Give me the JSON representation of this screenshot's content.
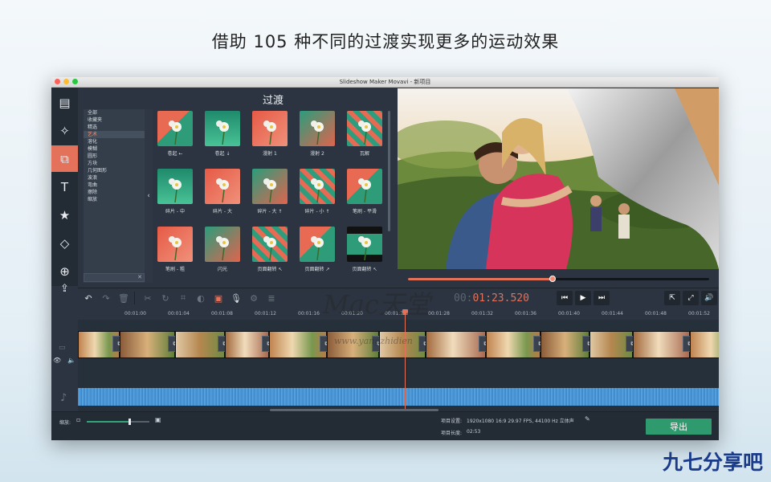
{
  "headline": "借助 105 种不同的过渡实现更多的运动效果",
  "window": {
    "title": "Slideshow Maker Movavi - 新项目",
    "traffic_lights": [
      "#ff5f57",
      "#febc2e",
      "#28c840"
    ]
  },
  "accent_color": "#e4715a",
  "tools": [
    {
      "name": "media-icon",
      "glyph": "▤",
      "active": false
    },
    {
      "name": "magic-wand-icon",
      "glyph": "✧",
      "active": false
    },
    {
      "name": "transitions-icon",
      "glyph": "⧉",
      "active": true
    },
    {
      "name": "text-icon",
      "glyph": "T",
      "active": false
    },
    {
      "name": "sticker-star-icon",
      "glyph": "★",
      "active": false
    },
    {
      "name": "shapes-icon",
      "glyph": "◇",
      "active": false
    },
    {
      "name": "zoom-icon",
      "glyph": "⊕",
      "active": false
    }
  ],
  "export_tool_glyph": "⇪",
  "transitions_panel": {
    "title": "过渡",
    "categories": [
      "全部",
      "收藏夹",
      "精选",
      "艺术",
      "溶化",
      "模糊",
      "圆形",
      "方块",
      "几何图形",
      "波浪",
      "弯曲",
      "擦除",
      "缩放"
    ],
    "selected_category": "艺术",
    "collapse_glyph": "‹",
    "search_clear_glyph": "✕",
    "items": [
      {
        "label": "卷起 ←"
      },
      {
        "label": "卷起 ↓"
      },
      {
        "label": "漫射 1"
      },
      {
        "label": "漫射 2"
      },
      {
        "label": "瓦解"
      },
      {
        "label": "碎片 - 中"
      },
      {
        "label": "碎片 - 大"
      },
      {
        "label": "碎片 - 大 ↑"
      },
      {
        "label": "碎片 - 小 ↑"
      },
      {
        "label": "笔刷 - 平滑"
      },
      {
        "label": "笔刷 - 粗"
      },
      {
        "label": "闪光"
      },
      {
        "label": "页面翻转 ↖"
      },
      {
        "label": "页面翻转 ↗"
      },
      {
        "label": "页面翻转 ↖"
      }
    ]
  },
  "preview": {
    "progress": 0.48
  },
  "toolbar": {
    "timecode_dim": "00:",
    "timecode_live": "01:23.520",
    "buttons": [
      {
        "name": "undo-icon",
        "glyph": "↶",
        "state": "normal"
      },
      {
        "name": "redo-icon",
        "glyph": "↷",
        "state": "dim"
      },
      {
        "name": "delete-icon",
        "glyph": "🗑",
        "state": "dim"
      },
      {
        "name": "cut-icon",
        "glyph": "✂",
        "state": "dim"
      },
      {
        "name": "rotate-icon",
        "glyph": "↻",
        "state": "dim"
      },
      {
        "name": "crop-icon",
        "glyph": "⌗",
        "state": "dim"
      },
      {
        "name": "color-adjust-icon",
        "glyph": "◐",
        "state": "dim"
      },
      {
        "name": "image-icon",
        "glyph": "▣",
        "state": "on"
      },
      {
        "name": "microphone-icon",
        "glyph": "🎙",
        "state": "normal"
      },
      {
        "name": "settings-icon",
        "glyph": "⚙",
        "state": "dim"
      },
      {
        "name": "equalizer-icon",
        "glyph": "≣",
        "state": "dim"
      }
    ],
    "player_buttons": [
      {
        "name": "skip-back-icon",
        "glyph": "⏮"
      },
      {
        "name": "play-icon",
        "glyph": "▶"
      },
      {
        "name": "skip-forward-icon",
        "glyph": "⏭"
      }
    ],
    "right_buttons": [
      {
        "name": "detach-preview-icon",
        "glyph": "⇱"
      },
      {
        "name": "fullscreen-icon",
        "glyph": "⤢"
      },
      {
        "name": "volume-icon",
        "glyph": "🔊"
      }
    ]
  },
  "timeline": {
    "ticks": [
      "00:01:00",
      "00:01:04",
      "00:01:08",
      "00:01:12",
      "00:01:16",
      "00:01:20",
      "00:01:24",
      "00:01:28",
      "00:01:32",
      "00:01:36",
      "00:01:40",
      "00:01:44",
      "00:01:48",
      "00:01:52",
      "00:01:5"
    ],
    "transition_glyph": "⧉",
    "video_track_icon": "▭",
    "eye_icon": "👁",
    "volume_icon": "🔈",
    "music_icon": "♪"
  },
  "bottom": {
    "zoom_label": "缩放:",
    "zoom_level": 0.68,
    "project_settings_label": "项目设置:",
    "project_settings_value": "1920x1080 16:9 29.97 FPS, 44100 Hz 立体声",
    "project_length_label": "项目长度:",
    "project_length_value": "02:53",
    "export_label": "导出",
    "edit_glyph": "✎"
  },
  "watermark": {
    "main": "Mac天堂",
    "sub": "www.yangzhidien"
  },
  "brand": "九七分享吧"
}
